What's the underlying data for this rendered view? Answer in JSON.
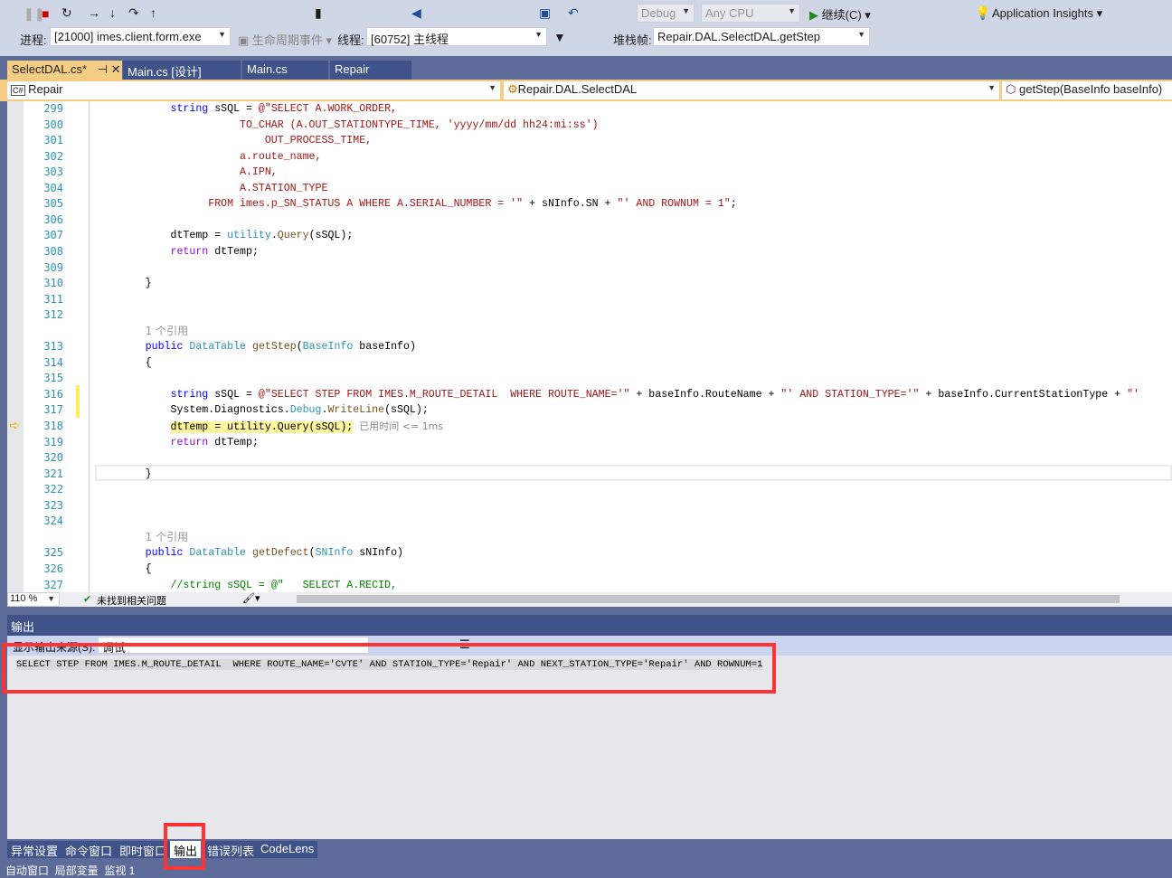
{
  "toolbar": {
    "config": "Debug",
    "platform": "Any CPU",
    "continue_label": "继续(C)",
    "insights_label": "Application Insights",
    "process_label": "进程:",
    "process_value": "[21000] imes.client.form.exe",
    "lifecycle_label": "生命周期事件",
    "thread_label": "线程:",
    "thread_value": "[60752] 主线程",
    "stack_label": "堆栈帧:",
    "stack_value": "Repair.DAL.SelectDAL.getStep"
  },
  "tabs": [
    {
      "label": "SelectDAL.cs*",
      "active": true
    },
    {
      "label": "Main.cs [设计]"
    },
    {
      "label": "Main.cs"
    },
    {
      "label": "Repair"
    }
  ],
  "navbar": {
    "project": "Repair",
    "class": "Repair.DAL.SelectDAL",
    "member": "getStep(BaseInfo baseInfo)"
  },
  "code": [
    {
      "n": "299",
      "s": [
        [
          "",
          "            "
        ],
        [
          "kw",
          "string"
        ],
        [
          "",
          " sSQL = "
        ],
        [
          "st",
          "@\"SELECT A.WORK_ORDER,"
        ]
      ]
    },
    {
      "n": "300",
      "s": [
        [
          "st",
          "                       TO_CHAR (A.OUT_STATIONTYPE_TIME, 'yyyy/mm/dd hh24:mi:ss')"
        ]
      ]
    },
    {
      "n": "301",
      "s": [
        [
          "st",
          "                           OUT_PROCESS_TIME,"
        ]
      ]
    },
    {
      "n": "302",
      "s": [
        [
          "st",
          "                       a.route_name,"
        ]
      ]
    },
    {
      "n": "303",
      "s": [
        [
          "st",
          "                       A.IPN,"
        ]
      ]
    },
    {
      "n": "304",
      "s": [
        [
          "st",
          "                       A.STATION_TYPE"
        ]
      ]
    },
    {
      "n": "305",
      "s": [
        [
          "st",
          "                  FROM imes.p_SN_STATUS A WHERE A.SERIAL_NUMBER = '\""
        ],
        [
          "",
          " + sNInfo.SN + "
        ],
        [
          "st",
          "\"' AND ROWNUM = 1\""
        ],
        [
          "",
          ";"
        ]
      ]
    },
    {
      "n": "306",
      "s": []
    },
    {
      "n": "307",
      "s": [
        [
          "",
          "            dtTemp = "
        ],
        [
          "ty",
          "utility"
        ],
        [
          "",
          "."
        ],
        [
          "me",
          "Query"
        ],
        [
          "",
          "(sSQL);"
        ]
      ]
    },
    {
      "n": "308",
      "s": [
        [
          "",
          "            "
        ],
        [
          "rt",
          "return"
        ],
        [
          "",
          " dtTemp;"
        ]
      ]
    },
    {
      "n": "309",
      "s": []
    },
    {
      "n": "310",
      "s": [
        [
          "",
          "        }"
        ]
      ]
    },
    {
      "n": "311",
      "s": []
    },
    {
      "n": "312",
      "s": []
    },
    {
      "n": "",
      "s": [
        [
          "",
          "        "
        ],
        [
          "lens",
          "1 个引用"
        ]
      ]
    },
    {
      "n": "313",
      "s": [
        [
          "",
          "        "
        ],
        [
          "kw",
          "public"
        ],
        [
          "",
          " "
        ],
        [
          "ty",
          "DataTable"
        ],
        [
          "",
          " "
        ],
        [
          "me",
          "getStep"
        ],
        [
          "",
          "("
        ],
        [
          "ty",
          "BaseInfo"
        ],
        [
          "",
          " baseInfo)"
        ]
      ]
    },
    {
      "n": "314",
      "s": [
        [
          "",
          "        {"
        ]
      ]
    },
    {
      "n": "315",
      "s": []
    },
    {
      "n": "316",
      "s": [
        [
          "",
          "            "
        ],
        [
          "kw",
          "string"
        ],
        [
          "",
          " sSQL = "
        ],
        [
          "st",
          "@\"SELECT STEP FROM IMES.M_ROUTE_DETAIL  WHERE ROUTE_NAME='\""
        ],
        [
          "",
          " + baseInfo.RouteName + "
        ],
        [
          "st",
          "\"' AND STATION_TYPE='\""
        ],
        [
          "",
          " + baseInfo.CurrentStationType + "
        ],
        [
          "st",
          "\"'"
        ]
      ]
    },
    {
      "n": "317",
      "s": [
        [
          "",
          "            System.Diagnostics."
        ],
        [
          "ty",
          "Debug"
        ],
        [
          "",
          "."
        ],
        [
          "me",
          "WriteLine"
        ],
        [
          "",
          "(sSQL);"
        ]
      ]
    },
    {
      "n": "318",
      "s": [
        [
          "",
          "            "
        ],
        [
          "hl",
          "dtTemp = utility.Query(sSQL);"
        ],
        [
          "",
          " "
        ],
        [
          "hint",
          "已用时间 <= 1ms"
        ]
      ]
    },
    {
      "n": "319",
      "s": [
        [
          "",
          "            "
        ],
        [
          "rt",
          "return"
        ],
        [
          "",
          " dtTemp;"
        ]
      ]
    },
    {
      "n": "320",
      "s": []
    },
    {
      "n": "321",
      "s": [
        [
          "",
          "        }"
        ]
      ]
    },
    {
      "n": "322",
      "s": []
    },
    {
      "n": "323",
      "s": []
    },
    {
      "n": "324",
      "s": []
    },
    {
      "n": "",
      "s": [
        [
          "",
          "        "
        ],
        [
          "lens",
          "1 个引用"
        ]
      ]
    },
    {
      "n": "325",
      "s": [
        [
          "",
          "        "
        ],
        [
          "kw",
          "public"
        ],
        [
          "",
          " "
        ],
        [
          "ty",
          "DataTable"
        ],
        [
          "",
          " "
        ],
        [
          "me",
          "getDefect"
        ],
        [
          "",
          "("
        ],
        [
          "ty",
          "SNInfo"
        ],
        [
          "",
          " sNInfo)"
        ]
      ]
    },
    {
      "n": "326",
      "s": [
        [
          "",
          "        {"
        ]
      ]
    },
    {
      "n": "327",
      "s": [
        [
          "",
          "            "
        ],
        [
          "cm",
          "//string sSQL = @\""
        ],
        [
          "cm",
          "   SELECT A.RECID,"
        ]
      ]
    }
  ],
  "status": {
    "zoom": "110 %",
    "issues": "未找到相关问题"
  },
  "output": {
    "title": "输出",
    "source_label": "显示输出来源(S):",
    "source_value": "调试",
    "text": "SELECT STEP FROM IMES.M_ROUTE_DETAIL  WHERE ROUTE_NAME='CVTE' AND STATION_TYPE='Repair' AND NEXT_STATION_TYPE='Repair' AND ROWNUM=1"
  },
  "bottom_tabs": [
    {
      "label": "异常设置"
    },
    {
      "label": "命令窗口"
    },
    {
      "label": "即时窗口"
    },
    {
      "label": "输出",
      "active": true
    },
    {
      "label": "错误列表"
    },
    {
      "label": "CodeLens"
    }
  ],
  "footer": "自动窗口  局部变量  监视 1",
  "colors": {
    "accent": "#f5cc84",
    "chrome": "#5d6b99",
    "highlight": "#ff3333"
  }
}
